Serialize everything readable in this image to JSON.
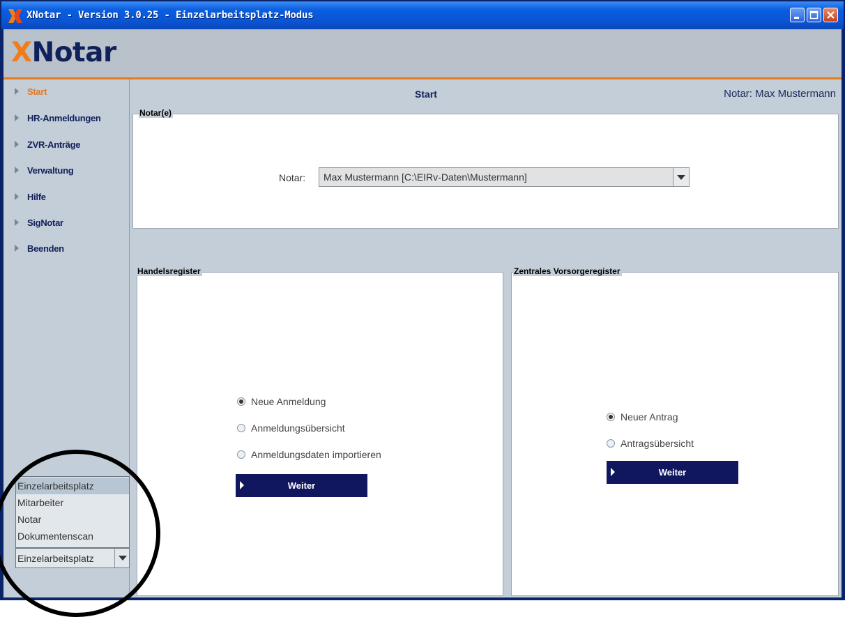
{
  "window": {
    "title": "XNotar - Version 3.0.25 - Einzelarbeitsplatz-Modus"
  },
  "header": {
    "logo_x": "X",
    "logo_rest": "Notar"
  },
  "sidebar": {
    "items": [
      {
        "label": "Start",
        "active": true
      },
      {
        "label": "HR-Anmeldungen"
      },
      {
        "label": "ZVR-Anträge"
      },
      {
        "label": "Verwaltung"
      },
      {
        "label": "Hilfe"
      },
      {
        "label": "SigNotar"
      },
      {
        "label": "Beenden"
      }
    ],
    "mode_options": [
      "Einzelarbeitsplatz",
      "Mitarbeiter",
      "Notar",
      "Dokumentenscan"
    ],
    "mode_selected": "Einzelarbeitsplatz"
  },
  "topbar": {
    "title": "Start",
    "notar_info": "Notar: Max Mustermann"
  },
  "notar_panel": {
    "title": "Notar(e)",
    "field_label": "Notar:",
    "selected_value": "Max Mustermann [C:\\EIRv-Daten\\Mustermann]"
  },
  "handelsregister": {
    "title": "Handelsregister",
    "options": [
      {
        "label": "Neue Anmeldung",
        "checked": true
      },
      {
        "label": "Anmeldungsübersicht",
        "checked": false
      },
      {
        "label": "Anmeldungsdaten importieren",
        "checked": false
      }
    ],
    "button": "Weiter"
  },
  "zvr": {
    "title": "Zentrales Vorsorgeregister",
    "options": [
      {
        "label": "Neuer Antrag",
        "checked": true
      },
      {
        "label": "Antragsübersicht",
        "checked": false
      }
    ],
    "button": "Weiter"
  },
  "colors": {
    "accent": "#f07d1a",
    "navy": "#10205a",
    "button_bg": "#10175e",
    "panel_bg": "#c4ced8"
  }
}
